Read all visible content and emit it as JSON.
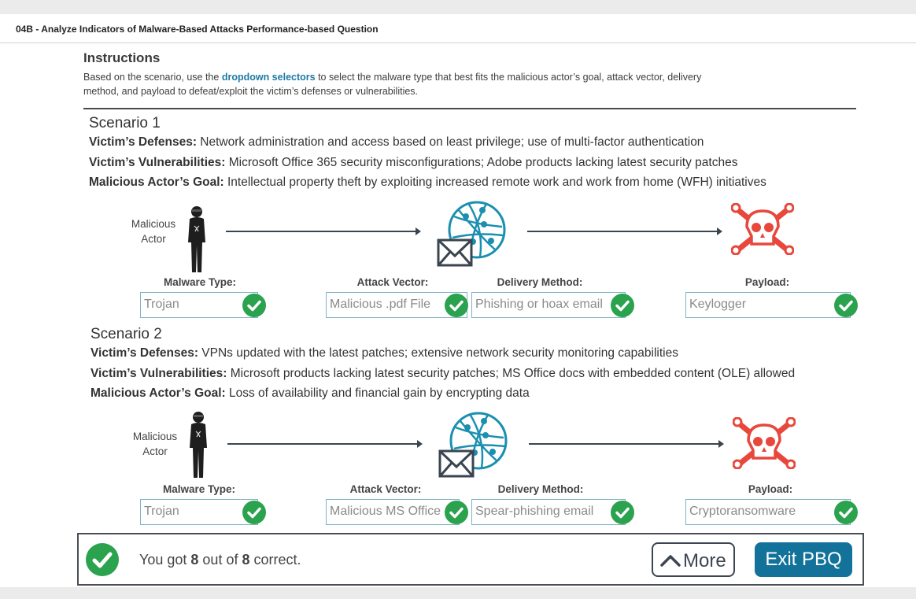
{
  "header": {
    "title": "04B - Analyze Indicators of Malware-Based Attacks Performance-based Question"
  },
  "instructions": {
    "heading": "Instructions",
    "text_before": "Based on the scenario, use the ",
    "highlight": "dropdown selectors",
    "text_after": " to select the malware type that best fits the malicious actor’s goal, attack vector, delivery method, and payload to defeat/exploit the victim’s defenses or vulnerabilities."
  },
  "scenarios": [
    {
      "title": "Scenario 1",
      "defenses_label": "Victim’s Defenses:",
      "defenses": " Network administration and access based on least privilege; use of multi-factor authentication",
      "vulnerabilities_label": "Victim’s Vulnerabilities:",
      "vulnerabilities": " Microsoft Office 365 security misconfigurations; Adobe products lacking latest security patches",
      "goal_label": "Malicious Actor’s Goal:",
      "goal": " Intellectual property theft by exploiting increased remote work and work from home (WFH) initiatives",
      "actor_line1": "Malicious",
      "actor_line2": "Actor",
      "malware_type_label": "Malware Type:",
      "malware_type": "Trojan",
      "attack_vector_label": "Attack Vector:",
      "attack_vector": "Malicious .pdf File",
      "delivery_method_label": "Delivery Method:",
      "delivery_method": "Phishing or hoax email",
      "payload_label": "Payload:",
      "payload": "Keylogger"
    },
    {
      "title": "Scenario 2",
      "defenses_label": "Victim’s Defenses:",
      "defenses": " VPNs updated with the latest patches; extensive network security monitoring capabilities",
      "vulnerabilities_label": "Victim’s Vulnerabilities:",
      "vulnerabilities": " Microsoft products lacking latest security patches; MS Office docs with embedded content (OLE) allowed",
      "goal_label": "Malicious Actor’s Goal:",
      "goal": " Loss of availability and financial gain by encrypting data",
      "actor_line1": "Malicious",
      "actor_line2": "Actor",
      "malware_type_label": "Malware Type:",
      "malware_type": "Trojan",
      "attack_vector_label": "Attack Vector:",
      "attack_vector": "Malicious MS Office",
      "delivery_method_label": "Delivery Method:",
      "delivery_method": "Spear-phishing email",
      "payload_label": "Payload:",
      "payload": "Cryptoransomware"
    }
  ],
  "result": {
    "prefix": "You got ",
    "correct": "8",
    "middle": " out of ",
    "total": "8",
    "suffix": " correct."
  },
  "buttons": {
    "more": "More",
    "exit": "Exit PBQ"
  },
  "colors": {
    "accent": "#12729a",
    "correct": "#2aa24e",
    "danger": "#e8473c",
    "globe": "#1b8fb0"
  },
  "icons": [
    "malicious-actor-icon",
    "globe-network-icon",
    "envelope-icon",
    "skull-crossbones-icon",
    "checkmark-icon",
    "chevron-up-icon"
  ]
}
